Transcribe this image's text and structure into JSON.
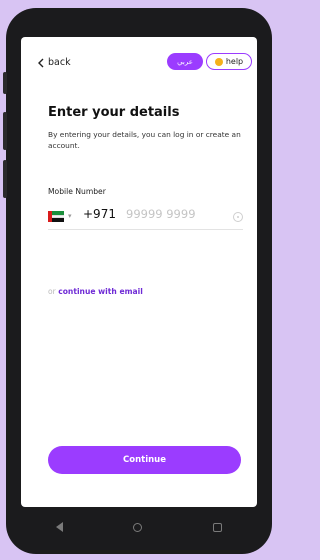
{
  "header": {
    "back_label": "back",
    "language_label": "عربي",
    "help_label": "help"
  },
  "page": {
    "title": "Enter your details",
    "subtitle": "By entering your details, you can log in or create an account."
  },
  "mobile": {
    "label": "Mobile Number",
    "country_flag": "uae-flag",
    "country_code": "+971",
    "placeholder": "99999 9999"
  },
  "alt_login": {
    "prefix": "or",
    "link": "continue with email"
  },
  "actions": {
    "continue_label": "Continue"
  },
  "colors": {
    "accent": "#9b3cff",
    "link": "#6f2bd6",
    "background": "#d8c4f3"
  }
}
